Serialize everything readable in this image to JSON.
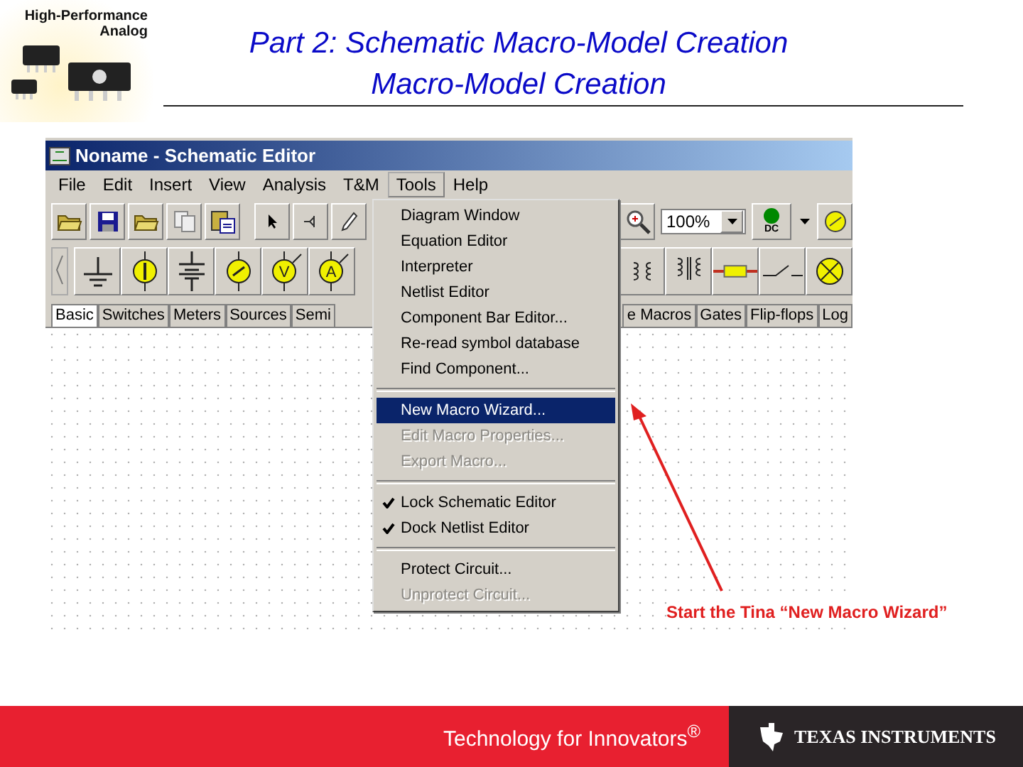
{
  "logo": {
    "lines": [
      "High-Performance",
      "Analog"
    ]
  },
  "title": {
    "lines": [
      "Part 2: Schematic Macro-Model Creation",
      "Macro-Model Creation"
    ]
  },
  "editor": {
    "window_title": "Noname - Schematic Editor",
    "menu": [
      {
        "label": "File",
        "selected": false
      },
      {
        "label": "Edit",
        "selected": false
      },
      {
        "label": "Insert",
        "selected": false
      },
      {
        "label": "View",
        "selected": false
      },
      {
        "label": "Analysis",
        "selected": false
      },
      {
        "label": "T&M",
        "selected": false
      },
      {
        "label": "Tools",
        "selected": true
      },
      {
        "label": "Help",
        "selected": false
      }
    ],
    "toolbar_left": [
      {
        "kind": "open"
      },
      {
        "kind": "save"
      },
      {
        "kind": "open"
      },
      {
        "kind": "copy"
      },
      {
        "kind": "paste"
      },
      {
        "kind": "pointer"
      },
      {
        "kind": "wire"
      },
      {
        "kind": "pencil"
      }
    ],
    "zoom_field": {
      "value": "100%"
    },
    "dc_label": "DC",
    "components_left": [
      {
        "kind": "ground"
      },
      {
        "kind": "current"
      },
      {
        "kind": "battery"
      },
      {
        "kind": "voltage"
      },
      {
        "kind": "meter",
        "symbol": "V"
      },
      {
        "kind": "meter",
        "symbol": "A"
      }
    ],
    "components_right": [
      {
        "kind": "coupled"
      },
      {
        "kind": "transformer"
      },
      {
        "kind": "fuse"
      },
      {
        "kind": "switch"
      },
      {
        "kind": "lamp"
      }
    ],
    "tabs_left": [
      {
        "label": "Basic",
        "selected": true
      },
      {
        "label": "Switches",
        "selected": false
      },
      {
        "label": "Meters",
        "selected": false
      },
      {
        "label": "Sources",
        "selected": false
      },
      {
        "label": "Semi",
        "selected": false
      }
    ],
    "tabs_right": [
      {
        "label": "e Macros",
        "selected": false
      },
      {
        "label": "Gates",
        "selected": false
      },
      {
        "label": "Flip-flops",
        "selected": false
      },
      {
        "label": "Log",
        "selected": false
      }
    ],
    "tools_menu": [
      {
        "kind": "item",
        "label": "Diagram Window",
        "disabled": false,
        "checked": false,
        "selected": false
      },
      {
        "kind": "item",
        "label": "Equation Editor",
        "disabled": false,
        "checked": false,
        "selected": false
      },
      {
        "kind": "item",
        "label": "Interpreter",
        "disabled": false,
        "checked": false,
        "selected": false
      },
      {
        "kind": "item",
        "label": "Netlist Editor",
        "disabled": false,
        "checked": false,
        "selected": false
      },
      {
        "kind": "item",
        "label": "Component Bar Editor...",
        "disabled": false,
        "checked": false,
        "selected": false
      },
      {
        "kind": "item",
        "label": "Re-read symbol database",
        "disabled": false,
        "checked": false,
        "selected": false
      },
      {
        "kind": "item",
        "label": "Find Component...",
        "disabled": false,
        "checked": false,
        "selected": false
      },
      {
        "kind": "separator"
      },
      {
        "kind": "item",
        "label": "New Macro Wizard...",
        "disabled": false,
        "checked": false,
        "selected": true
      },
      {
        "kind": "item",
        "label": "Edit Macro Properties...",
        "disabled": true,
        "checked": false,
        "selected": false
      },
      {
        "kind": "item",
        "label": "Export Macro...",
        "disabled": true,
        "checked": false,
        "selected": false
      },
      {
        "kind": "separator"
      },
      {
        "kind": "item",
        "label": "Lock Schematic Editor",
        "disabled": false,
        "checked": true,
        "selected": false
      },
      {
        "kind": "item",
        "label": "Dock Netlist Editor",
        "disabled": false,
        "checked": true,
        "selected": false
      },
      {
        "kind": "separator"
      },
      {
        "kind": "item",
        "label": "Protect Circuit...",
        "disabled": false,
        "checked": false,
        "selected": false
      },
      {
        "kind": "item",
        "label": "Unprotect Circuit...",
        "disabled": true,
        "checked": false,
        "selected": false
      }
    ]
  },
  "callout": {
    "text": "Start the Tina “New Macro Wizard”"
  },
  "footer": {
    "tagline": "Technology for Innovators$^{®}$",
    "brand": "TEXAS INSTRUMENTS"
  }
}
